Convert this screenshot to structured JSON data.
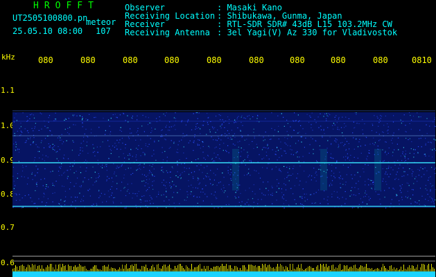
{
  "header": {
    "app_title": "HROFFT",
    "file_name": "UT2505100800.pn",
    "file_suffix": "meteor",
    "date_time": "25.05.10 08:00",
    "count": "107"
  },
  "metadata": [
    {
      "label": "Observer",
      "value": ": Masaki Kano"
    },
    {
      "label": "Receiving Location",
      "value": ": Shibukawa, Gunma, Japan"
    },
    {
      "label": "Receiver",
      "value": ": RTL-SDR SDR# 43dB L15 103.2MHz CW"
    },
    {
      "label": "Receiving Antenna",
      "value": ": 3el Yagi(V) Az 330 for Vladivostok"
    }
  ],
  "axis": {
    "unit": "kHz",
    "time_ticks": [
      "080",
      "080",
      "080",
      "080",
      "080",
      "080",
      "080",
      "080",
      "080",
      "0810"
    ],
    "freq_ticks": [
      "1.1",
      "1.0",
      "0.9",
      "0.8",
      "0.7",
      "0.6"
    ]
  },
  "colors": {
    "background": "#000000",
    "header_text": "#00ffff",
    "title_text": "#00ff00",
    "axis_text": "#ffff00",
    "spectrum_low": "#0a1a8a",
    "spectrum_high": "#38e8ff"
  }
}
